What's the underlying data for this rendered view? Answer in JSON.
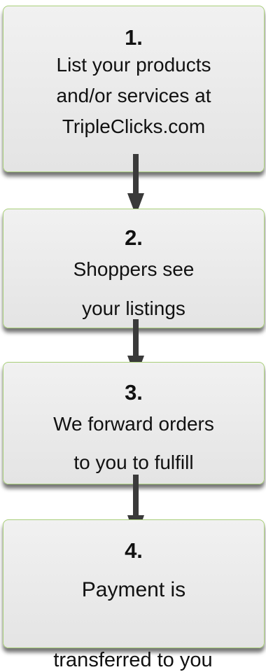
{
  "steps": [
    {
      "number": "1.",
      "lines": [
        "List your products",
        "and/or services at",
        "TripleClicks.com"
      ]
    },
    {
      "number": "2.",
      "lines": [
        "Shoppers see",
        "your listings"
      ]
    },
    {
      "number": "3.",
      "lines": [
        "We forward orders",
        "to you to fulfill"
      ]
    },
    {
      "number": "4.",
      "lines": [
        "Payment is"
      ]
    }
  ],
  "step4_overflow_line": "transferred to you",
  "colors": {
    "box_border": "#a9cf7a",
    "box_fill": "#eaeaea",
    "arrow": "#3a3a3a",
    "text": "#111111"
  }
}
